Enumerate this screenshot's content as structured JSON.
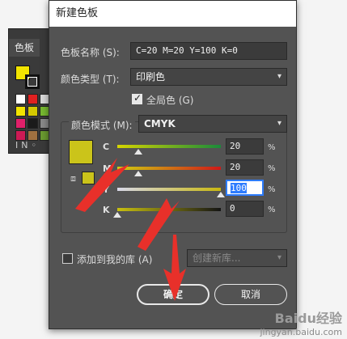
{
  "panel": {
    "tab_label": "色板",
    "footer_icons": "IN◦",
    "swatch_colors": [
      "#ffffff",
      "#e02020",
      "#d8d8d8",
      "#f2e400",
      "#d4c800",
      "#76b830",
      "#e0206a",
      "#1a1a1a",
      "#888888",
      "#cc1a55",
      "#a07040",
      "#6a9a30"
    ]
  },
  "dialog": {
    "title": "新建色板",
    "name_label": "色板名称 (S):",
    "name_value": "C=20 M=20 Y=100 K=0",
    "type_label": "颜色类型 (T):",
    "type_value": "印刷色",
    "global_label": "全局色 (G)",
    "global_checked": true,
    "mode_label": "颜色模式 (M):",
    "mode_value": "CMYK",
    "swatch_color": "#cbc41a",
    "cube_icon": "⧈",
    "percent_sign": "%",
    "sliders": [
      {
        "label": "C",
        "value": "20",
        "level": 0.2
      },
      {
        "label": "M",
        "value": "20",
        "level": 0.2
      },
      {
        "label": "Y",
        "value": "100",
        "level": 1.0
      },
      {
        "label": "K",
        "value": "0",
        "level": 0.0
      }
    ],
    "library_label": "添加到我的库 (A)",
    "library_select": "创建新库...",
    "ok_label": "确定",
    "cancel_label": "取消"
  },
  "watermark": {
    "brand": "Baidu经验",
    "url": "jingyan.baidu.com"
  }
}
